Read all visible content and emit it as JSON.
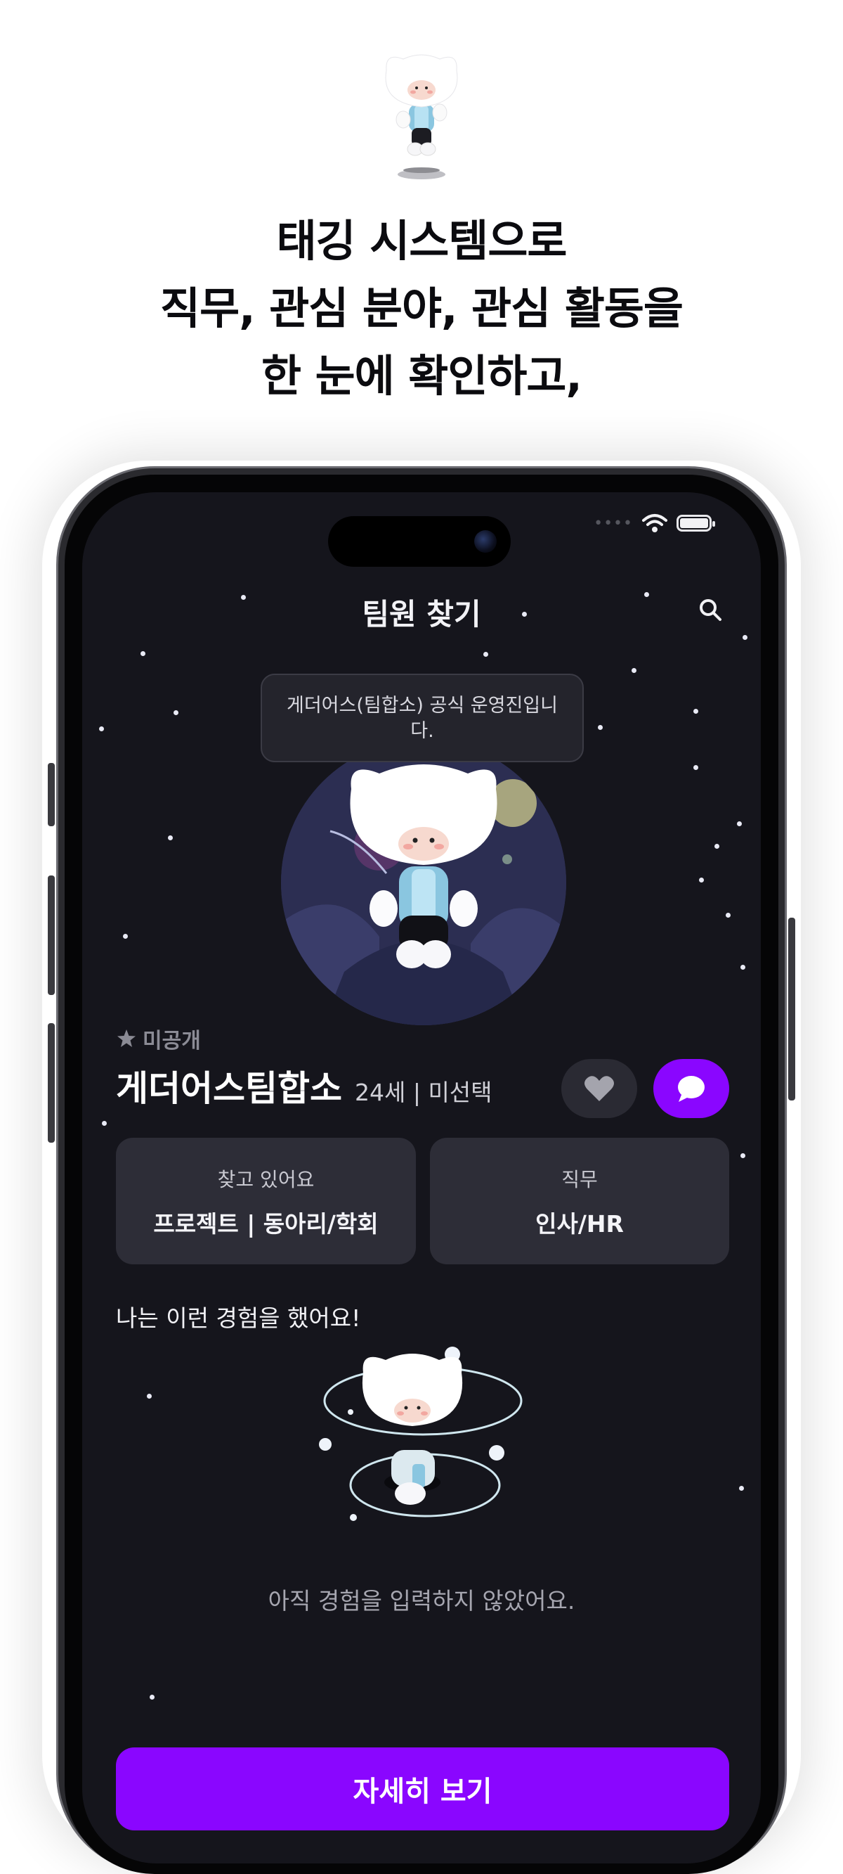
{
  "headline": {
    "line1": "태깅 시스템으로",
    "line2": "직무, 관심 분야, 관심 활동을",
    "line3": "한 눈에 확인하고,"
  },
  "screen": {
    "nav_title": "팀원 찾기",
    "tooltip": "게더어스(팀합소) 공식 운영진입니다.",
    "profile": {
      "visibility": "미공개",
      "name": "게더어스팀합소",
      "age_gender": "24세 | 미선택"
    },
    "cards": {
      "looking_label": "찾고 있어요",
      "looking_value": "프로젝트 | 동아리/학회",
      "job_label": "직무",
      "job_value": "인사/HR"
    },
    "experience": {
      "heading": "나는 이런 경험을 했어요!",
      "empty_text": "아직 경험을 입력하지 않았어요."
    },
    "detail_button": "자세히 보기"
  },
  "colors": {
    "screen_bg": "#15151c",
    "accent": "#8a06ff",
    "card_bg": "#2d2d37"
  },
  "icons": [
    "wifi-icon",
    "battery-icon",
    "search-icon",
    "star-icon",
    "heart-icon",
    "chat-bubble-icon"
  ]
}
